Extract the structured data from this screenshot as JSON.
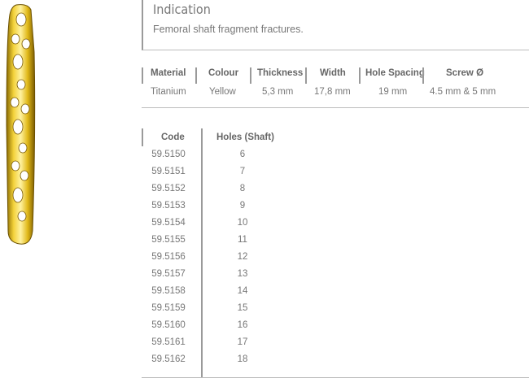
{
  "indication": {
    "title": "Indication",
    "description": "Femoral shaft fragment fractures."
  },
  "specs": [
    {
      "header": "Material",
      "value": "Titanium"
    },
    {
      "header": "Colour",
      "value": "Yellow"
    },
    {
      "header": "Thickness",
      "value": "5,3 mm"
    },
    {
      "header": "Width",
      "value": "17,8 mm"
    },
    {
      "header": "Hole Spacing",
      "value": "19 mm"
    },
    {
      "header": "Screw Ø",
      "value": "4.5 mm & 5 mm"
    }
  ],
  "codes": {
    "header_code": "Code",
    "header_holes": "Holes (Shaft)",
    "rows": [
      {
        "code": "59.5150",
        "holes": "6"
      },
      {
        "code": "59.5151",
        "holes": "7"
      },
      {
        "code": "59.5152",
        "holes": "8"
      },
      {
        "code": "59.5153",
        "holes": "9"
      },
      {
        "code": "59.5154",
        "holes": "10"
      },
      {
        "code": "59.5155",
        "holes": "11"
      },
      {
        "code": "59.5156",
        "holes": "12"
      },
      {
        "code": "59.5157",
        "holes": "13"
      },
      {
        "code": "59.5158",
        "holes": "14"
      },
      {
        "code": "59.5159",
        "holes": "15"
      },
      {
        "code": "59.5160",
        "holes": "16"
      },
      {
        "code": "59.5161",
        "holes": "17"
      },
      {
        "code": "59.5162",
        "holes": "18"
      }
    ]
  },
  "colors": {
    "plate_gold": "#d9b51a",
    "plate_highlight": "#fff2a0",
    "divider": "#9a9a9a",
    "text": "#777777"
  }
}
